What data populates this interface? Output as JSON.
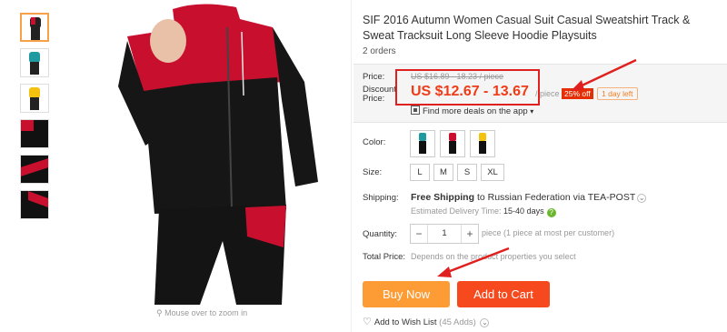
{
  "gallery": {
    "thumbnails": [
      {
        "name": "thumb-black-red",
        "style": "figure",
        "top_color": "#222222",
        "accent": "#c8102e"
      },
      {
        "name": "thumb-teal",
        "style": "figure",
        "top_color": "#1e9aa0",
        "accent": "#222222"
      },
      {
        "name": "thumb-yellow",
        "style": "figure",
        "top_color": "#f2c20f",
        "accent": "#222222"
      },
      {
        "name": "thumb-detail-1",
        "style": "swatch"
      },
      {
        "name": "thumb-detail-2",
        "style": "swatch"
      },
      {
        "name": "thumb-detail-3",
        "style": "swatch"
      }
    ],
    "zoom_hint": "Mouse over to zoom in"
  },
  "product": {
    "title": "SIF 2016 Autumn Women Casual Suit Casual Sweatshirt Track & Sweat Tracksuit Long Sleeve Hoodie Playsuits",
    "orders": "2 orders"
  },
  "pricing": {
    "price_label": "Price:",
    "old_price": "US $16.89 - 18.23 / piece",
    "discount_label": "Discount Price:",
    "new_price": "US $12.67 - 13.67",
    "per_piece": "/ piece",
    "discount_badge": "25% off",
    "time_left": "1 day left",
    "app_deals": "Find more deals on the app",
    "app_deals_chevron": "▾"
  },
  "options": {
    "color_label": "Color:",
    "colors": [
      {
        "name": "black-teal",
        "top": "#1e9aa0"
      },
      {
        "name": "black-red",
        "top": "#c8102e"
      },
      {
        "name": "black-yellow",
        "top": "#f2c20f"
      }
    ],
    "size_label": "Size:",
    "sizes": [
      "L",
      "M",
      "S",
      "XL"
    ]
  },
  "shipping": {
    "label": "Shipping:",
    "free_text": "Free Shipping",
    "to_text": "to Russian Federation via TEA-POST",
    "chevron": "⌄",
    "delivery_label": "Estimated Delivery Time:",
    "delivery_value": "15-40",
    "delivery_unit": "days",
    "help_icon": "?"
  },
  "quantity": {
    "label": "Quantity:",
    "minus": "−",
    "value": "1",
    "plus": "+",
    "note": "piece (1 piece at most per customer)"
  },
  "total": {
    "label": "Total Price:",
    "note": "Depends on the product properties you select"
  },
  "actions": {
    "buy_now": "Buy Now",
    "add_to_cart": "Add to Cart",
    "wishlist_icon": "♡",
    "wishlist": "Add to Wish List",
    "wishlist_count": "(45 Adds)",
    "wishlist_chevron": "⌄"
  },
  "colors": {
    "price_red": "#f03b17",
    "annotation_red": "#e0201e",
    "buy_now_orange": "#fd9b34",
    "cart_red": "#f64a1e",
    "suit_red": "#c8102e",
    "suit_black": "#141414"
  }
}
